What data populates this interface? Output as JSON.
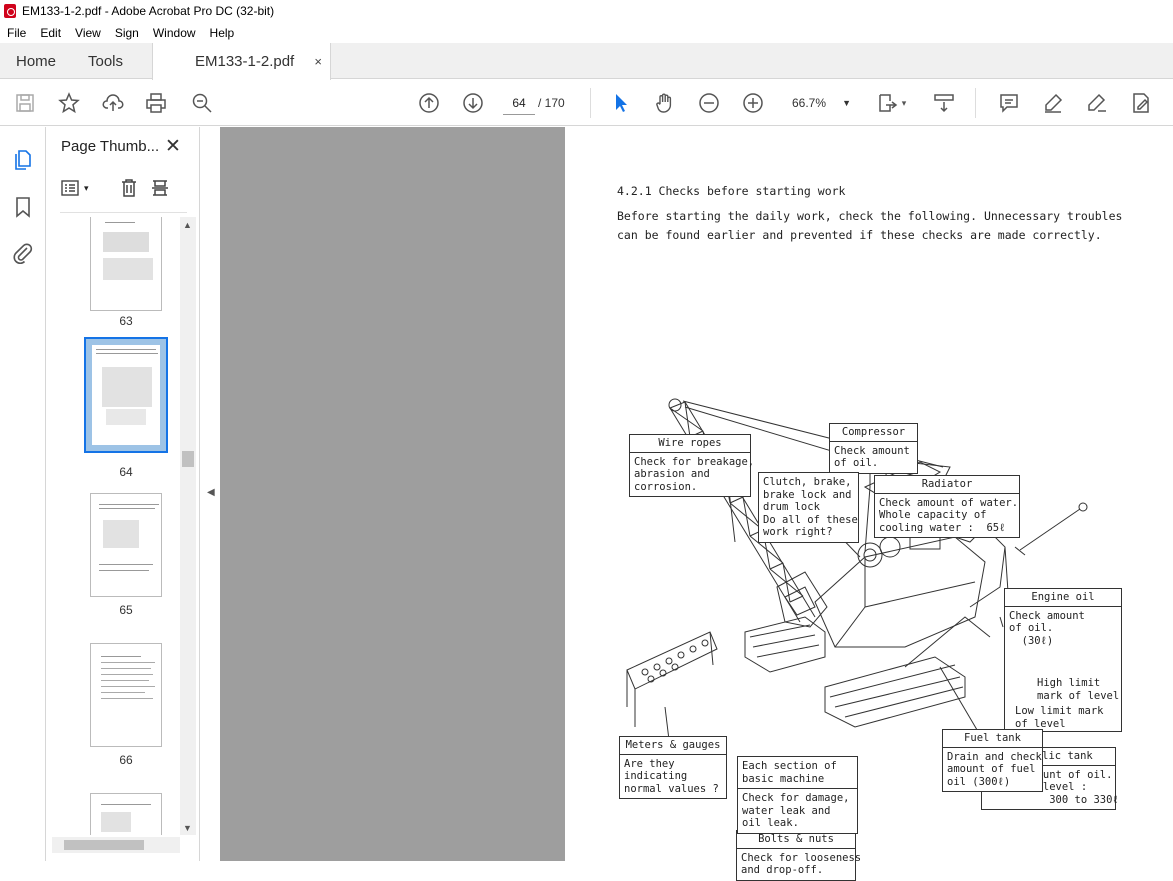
{
  "window": {
    "title": "EM133-1-2.pdf - Adobe Acrobat Pro DC (32-bit)"
  },
  "menu": [
    "File",
    "Edit",
    "View",
    "Sign",
    "Window",
    "Help"
  ],
  "tabs": {
    "home": "Home",
    "tools": "Tools",
    "doc": "EM133-1-2.pdf",
    "close": "×"
  },
  "toolbar": {
    "page_current": "64",
    "page_total": "/ 170",
    "zoom": "66.7%"
  },
  "thumbnails": {
    "title": "Page Thumb...",
    "close": "✕",
    "pages": [
      {
        "label": "63"
      },
      {
        "label": "64"
      },
      {
        "label": "65"
      },
      {
        "label": "66"
      }
    ]
  },
  "document": {
    "heading": "4.2.1  Checks before starting work",
    "paragraph": "Before starting the daily work, check the following.  Unnecessary troubles can be found earlier and prevented if these checks are made correctly.",
    "labels": {
      "wire_ropes": {
        "title": "Wire ropes",
        "body": "Check for breakage,\nabrasion and\ncorrosion."
      },
      "compressor": {
        "title": "Compressor",
        "body": "Check amount\nof oil."
      },
      "clutch": {
        "body": "Clutch, brake,\nbrake lock and\ndrum lock\nDo all of these\nwork right?"
      },
      "radiator": {
        "title": "Radiator",
        "body": "Check amount of water.\nWhole capacity of\ncooling water :  65ℓ"
      },
      "engine_oil": {
        "title": "Engine oil",
        "body": "Check amount\nof oil.\n  (30ℓ)",
        "high": "High limit\nmark of level",
        "low": "Low limit mark\nof level"
      },
      "hydraulic_tank": {
        "title": "Hydraulic tank",
        "body": "Check amount of oil.\nStandard level :\n          300 to 330ℓ"
      },
      "bolts_nuts": {
        "title": "Bolts & nuts",
        "body": "Check for looseness\nand drop-off."
      },
      "section": {
        "body": "Each section of\nbasic machine"
      },
      "damage": {
        "body": "Check for damage,\nwater leak and\noil leak."
      },
      "meters": {
        "title": "Meters & gauges",
        "body": "Are they\nindicating\nnormal values ?"
      },
      "fuel_tank": {
        "title": "Fuel tank",
        "body": "Drain and check\namount of fuel\noil (300ℓ)"
      }
    }
  }
}
